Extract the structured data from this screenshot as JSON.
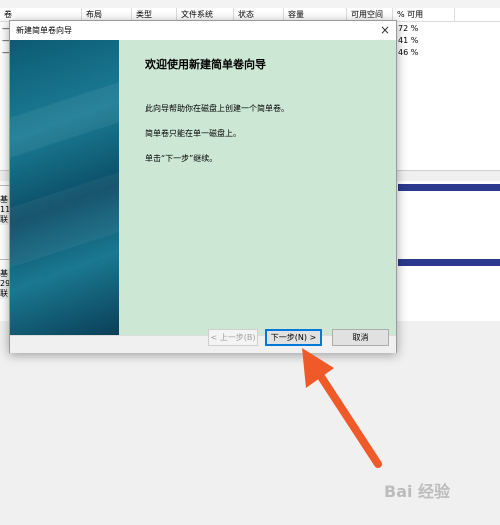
{
  "background": {
    "columns": [
      "卷",
      "布局",
      "类型",
      "文件系统",
      "状态",
      "容量",
      "可用空间",
      "% 可用"
    ],
    "volume_rows": [
      {
        "c1": "—",
        "pct": "72 %"
      },
      {
        "c1": "—",
        "pct": "41 %"
      },
      {
        "c1": "—",
        "pct": "46 %"
      }
    ],
    "disk1": {
      "line1": "基",
      "line2": "11",
      "line3": "联"
    },
    "disk2": {
      "line1": "基",
      "line2": "29",
      "line3": "联"
    }
  },
  "dialog": {
    "title": "新建简单卷向导",
    "close_glyph": "×",
    "heading": "欢迎使用新建简单卷向导",
    "para1": "此向导帮助你在磁盘上创建一个简单卷。",
    "para2": "简单卷只能在单一磁盘上。",
    "para3": "单击“下一步”继续。",
    "back_label": "< 上一步(B)",
    "next_label": "下一步(N) >",
    "cancel_label": "取消"
  },
  "annotation": {
    "arrow_color": "#f05a28"
  },
  "watermark": {
    "text": "Bai 经验"
  }
}
